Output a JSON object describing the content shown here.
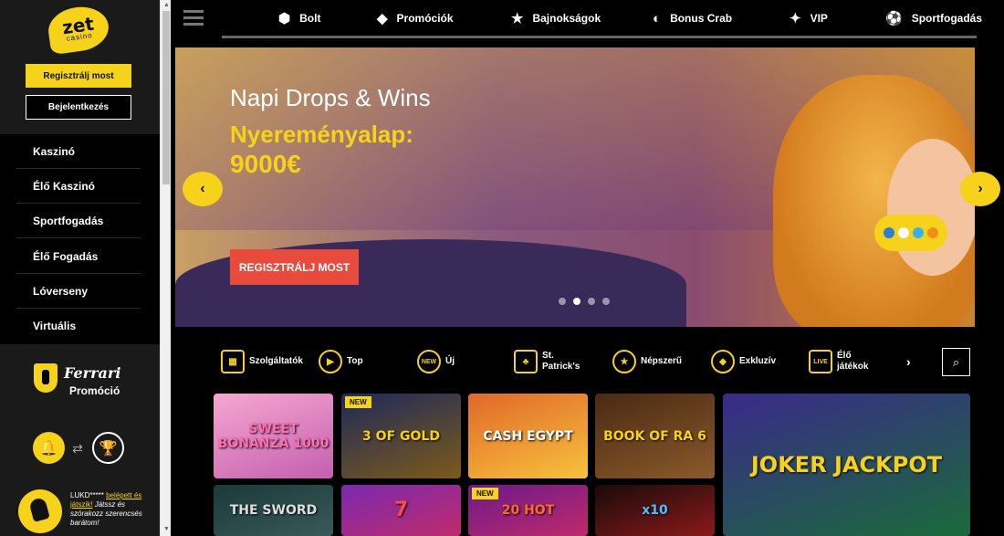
{
  "logo": {
    "line1": "zet",
    "line2": "casino"
  },
  "auth": {
    "register": "Regisztrálj most",
    "login": "Bejelentkezés"
  },
  "sidebar_menu": [
    "Kaszinó",
    "Élő Kaszinó",
    "Sportfogadás",
    "Élő Fogadás",
    "Lóverseny",
    "Virtuális"
  ],
  "ferrari": {
    "brand": "Ferrari",
    "promo": "Promóció"
  },
  "chat": {
    "user": "LUKD*****",
    "link": "belépett és játszik!",
    "message": "Játssz és szórakozz szerencsés barátom!"
  },
  "topnav": [
    {
      "label": "Bolt",
      "icon": "tag-icon",
      "glyph": "⬢"
    },
    {
      "label": "Promóciók",
      "icon": "diamond-icon",
      "glyph": "◆"
    },
    {
      "label": "Bajnokságok",
      "icon": "trophy-star-icon",
      "glyph": "★"
    },
    {
      "label": "Bonus Crab",
      "icon": "crab-icon",
      "glyph": "◐"
    },
    {
      "label": "VIP",
      "icon": "vip-stars-icon",
      "glyph": "✦"
    },
    {
      "label": "Sportfogadás",
      "icon": "soccer-ball-icon",
      "glyph": "⚽"
    }
  ],
  "hero": {
    "title": "Napi Drops & Wins",
    "subtitle": "Nyereményalap:",
    "amount": "9000€",
    "cta": "REGISZTRÁLJ MOST"
  },
  "categories": [
    {
      "label": "Szolgáltatók",
      "icon": "providers-icon"
    },
    {
      "label": "Top",
      "icon": "play-icon"
    },
    {
      "label": "Új",
      "icon": "new-icon"
    },
    {
      "label": "St. Patrick's",
      "icon": "hat-icon"
    },
    {
      "label": "Népszerű",
      "icon": "star-icon"
    },
    {
      "label": "Exkluzív",
      "icon": "diamond-icon"
    },
    {
      "label": "Élő játékok",
      "icon": "live-icon"
    }
  ],
  "games": [
    {
      "title": "SWEET BONANZA 1000",
      "badge": ""
    },
    {
      "title": "3 OF GOLD",
      "badge": "NEW"
    },
    {
      "title": "CASH EGYPT",
      "badge": ""
    },
    {
      "title": "BOOK OF RA 6",
      "badge": ""
    },
    {
      "title": "JOKER JACKPOT",
      "badge": ""
    },
    {
      "title": "THE SWORD",
      "badge": ""
    },
    {
      "title": "7",
      "badge": ""
    },
    {
      "title": "20 HOT",
      "badge": "NEW"
    },
    {
      "title": "x10",
      "badge": ""
    }
  ],
  "colors": {
    "accent": "#f7d21a",
    "cta": "#e84a3c",
    "sidebar": "#1a1a1a"
  }
}
